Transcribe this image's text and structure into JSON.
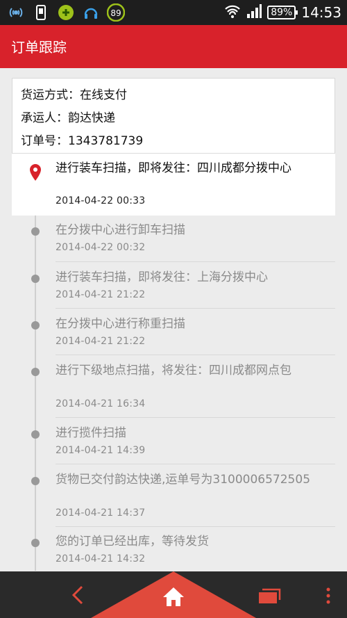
{
  "status_bar": {
    "battery": "89%",
    "time": "14:53",
    "notification_badge": "89",
    "icons": [
      "signal-antenna-icon",
      "phone-download-icon",
      "app-badge-icon",
      "headset-icon",
      "security-89-icon",
      "wifi-icon",
      "cellular-signal-icon",
      "battery-icon"
    ]
  },
  "action_bar": {
    "title": "订单跟踪"
  },
  "order_info": {
    "shipping_method": "货运方式：在线支付",
    "carrier": "承运人：韵达快递",
    "order_number": "订单号：1343781739"
  },
  "timeline": [
    {
      "text": "进行装车扫描，即将发往：四川成都分拨中心",
      "time": "2014-04-22  00:33",
      "active": true
    },
    {
      "text": "在分拨中心进行卸车扫描",
      "time": "2014-04-22  00:32",
      "active": false
    },
    {
      "text": "进行装车扫描，即将发往：上海分拨中心",
      "time": "2014-04-21  21:22",
      "active": false
    },
    {
      "text": "在分拨中心进行称重扫描",
      "time": "2014-04-21  21:22",
      "active": false
    },
    {
      "text": "进行下级地点扫描，将发往：四川成都网点包",
      "time": "2014-04-21  16:34",
      "active": false
    },
    {
      "text": "进行揽件扫描",
      "time": "2014-04-21  14:39",
      "active": false
    },
    {
      "text": "货物已交付韵达快递,运单号为3100006572505",
      "time": "2014-04-21  14:37",
      "active": false
    },
    {
      "text": "您的订单已经出库，等待发货",
      "time": "2014-04-21  14:32",
      "active": false
    }
  ],
  "bottom_nav": {
    "icons": [
      "back-chevron-icon",
      "home-icon",
      "recent-apps-icon",
      "overflow-menu-icon"
    ],
    "colors": {
      "bar": "#2a2a2a",
      "accent": "#e04a3c"
    }
  },
  "colors": {
    "primary": "#d8222b",
    "pin": "#d8222b"
  }
}
